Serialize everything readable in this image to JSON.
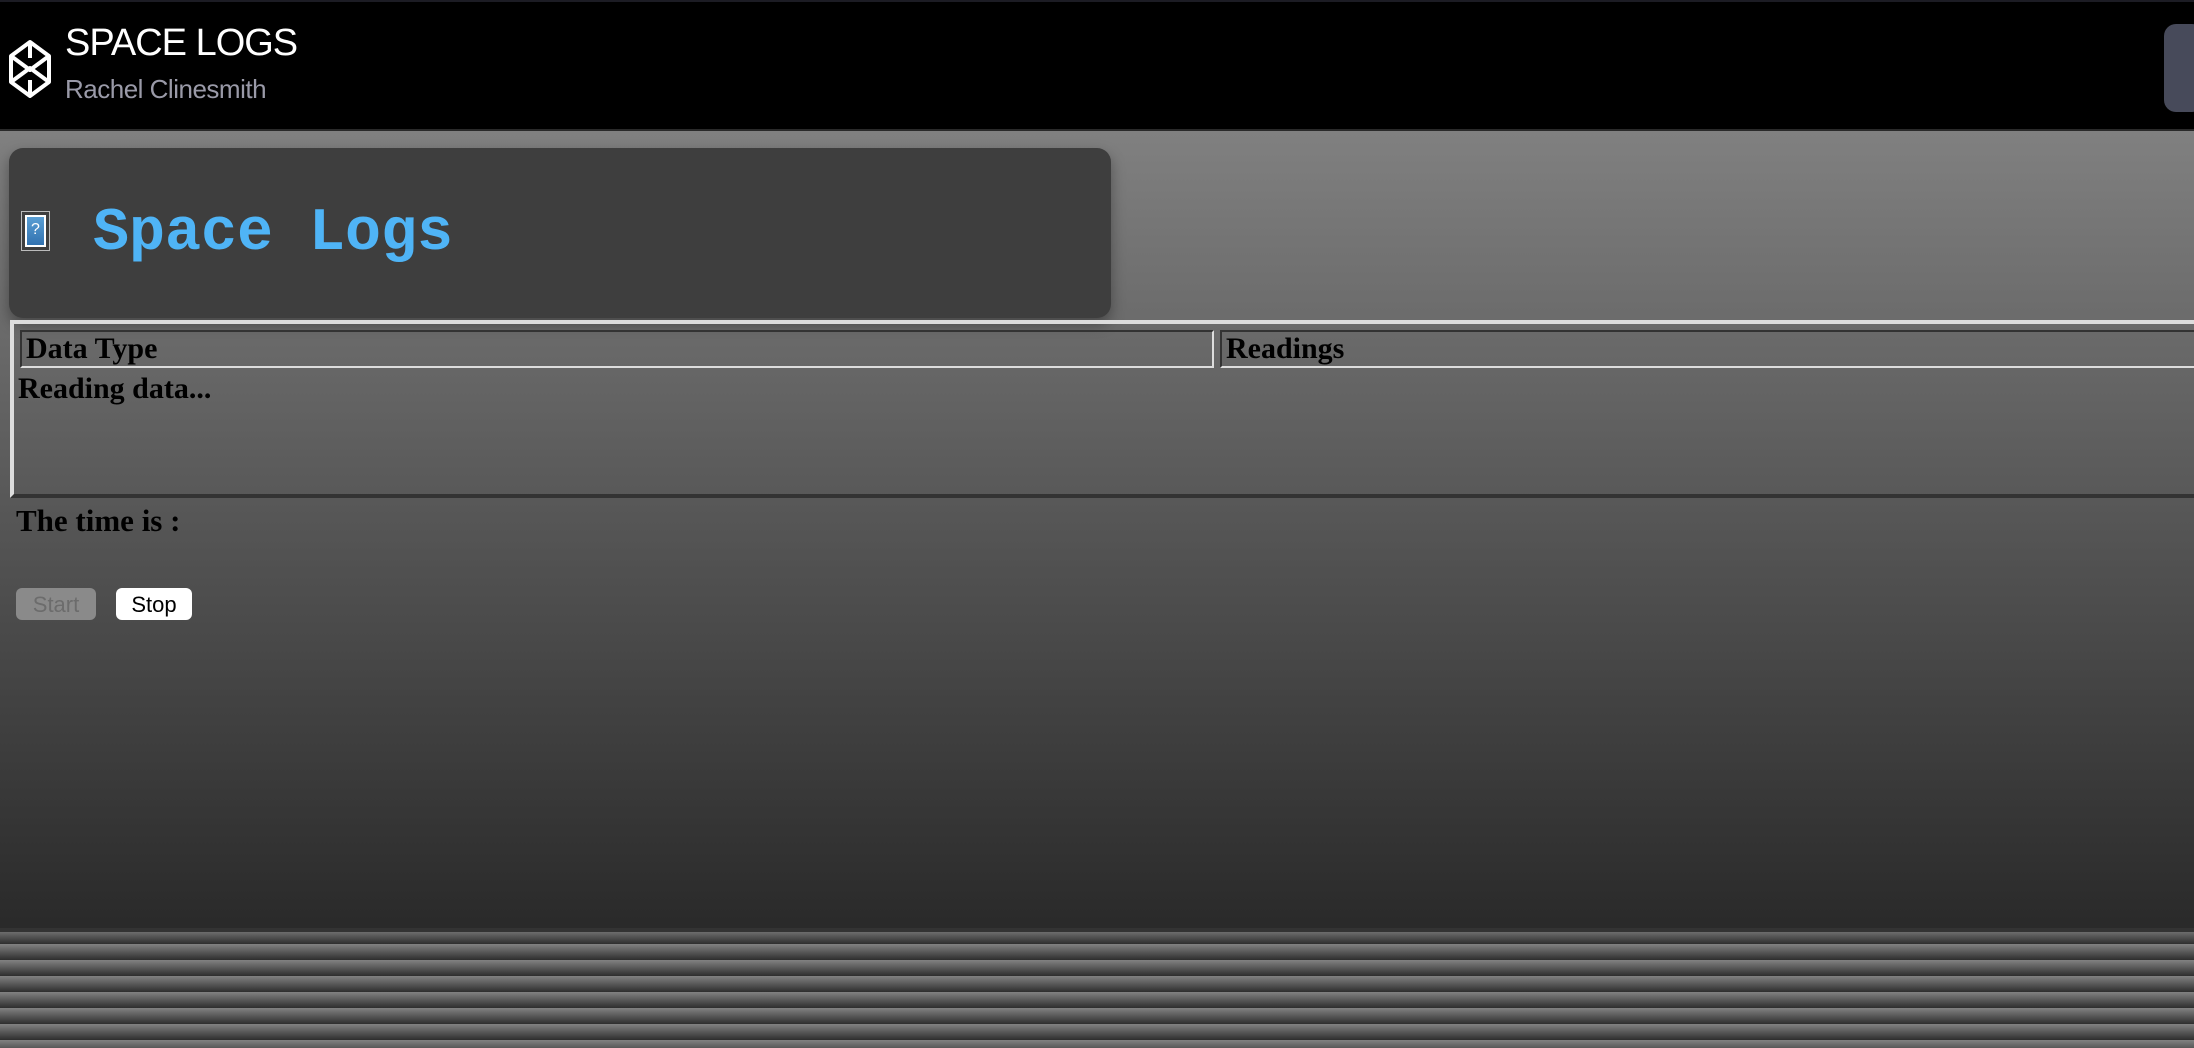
{
  "header": {
    "title": "SPACE LOGS",
    "author": "Rachel Clinesmith",
    "logo_icon": "codepen-cube-icon"
  },
  "card": {
    "title": "Space Logs",
    "image_icon": "broken-image-icon",
    "image_glyph": "?"
  },
  "table": {
    "columns": [
      "Data Type",
      "Readings"
    ],
    "status": "Reading data..."
  },
  "time_label": "The time is :",
  "buttons": {
    "start": "Start",
    "stop": "Stop"
  }
}
